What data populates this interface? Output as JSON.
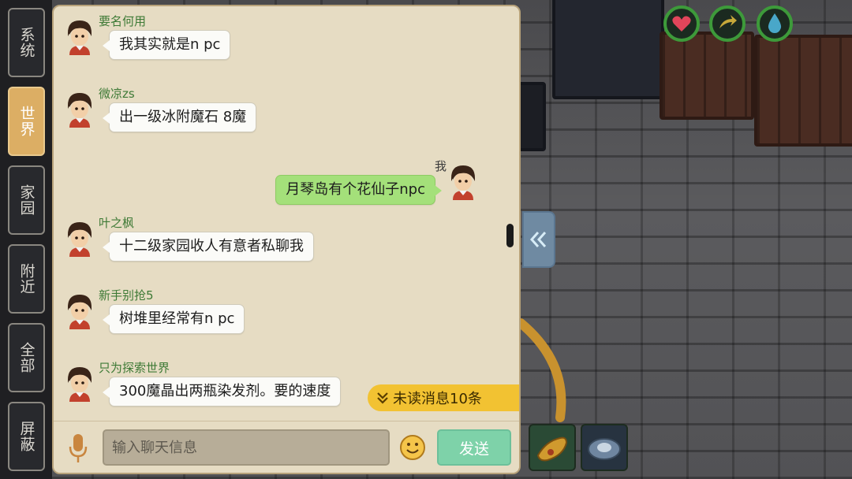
{
  "tabs": [
    {
      "label": "系统",
      "active": false
    },
    {
      "label": "世界",
      "active": true
    },
    {
      "label": "家园",
      "active": false
    },
    {
      "label": "附近",
      "active": false
    },
    {
      "label": "全部",
      "active": false
    },
    {
      "label": "屏蔽",
      "active": false
    }
  ],
  "messages": [
    {
      "name": "要名何用",
      "text": "我其实就是n pc",
      "self": false
    },
    {
      "name": "微凉zs",
      "text": "出一级冰附魔石 8魔",
      "self": false
    },
    {
      "name": "我",
      "text": "月琴岛有个花仙子npc",
      "self": true
    },
    {
      "name": "叶之枫",
      "text": "十二级家园收人有意者私聊我",
      "self": false
    },
    {
      "name": "新手别抢5",
      "text": "树堆里经常有n pc",
      "self": false
    },
    {
      "name": "只为探索世界",
      "text": "300魔晶出两瓶染发剂。要的速度",
      "self": false
    }
  ],
  "unread": {
    "label": "未读消息10条"
  },
  "input": {
    "placeholder": "输入聊天信息"
  },
  "send_label": "发送",
  "icons": {
    "mic": "microphone-icon",
    "emoji": "smiley-icon",
    "collapse": "double-chevron-left-icon",
    "status": [
      "heart-icon",
      "stamina-icon",
      "water-drop-icon"
    ]
  },
  "colors": {
    "active_tab": "#dcae64",
    "self_bubble": "#a4e07a",
    "name_green": "#3e7a36",
    "send_button": "#7ed2a9",
    "unread_badge": "#f2c232"
  }
}
